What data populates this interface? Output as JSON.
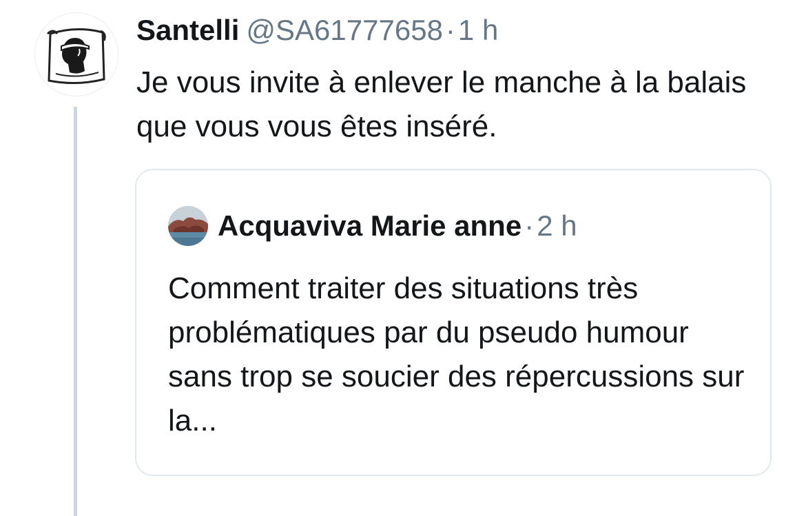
{
  "tweet": {
    "display_name": "Santelli",
    "handle": "@SA61777658",
    "separator": "·",
    "time": "1 h",
    "text": "Je vous invite à enlever le manche à la balais que vous vous êtes inséré.",
    "avatar_icon": "moor-head-icon"
  },
  "quoted_tweet": {
    "display_name": "Acquaviva Marie anne",
    "separator": "·",
    "time": "2 h",
    "text": "Comment traiter des situations très problématiques par du pseudo humour sans trop se soucier des répercussions sur la...",
    "avatar_icon": "landscape-photo-icon"
  },
  "colors": {
    "text": "#14171a",
    "secondary": "#657786",
    "border": "#e1e8ed",
    "thread_line": "#ccd6dd"
  }
}
